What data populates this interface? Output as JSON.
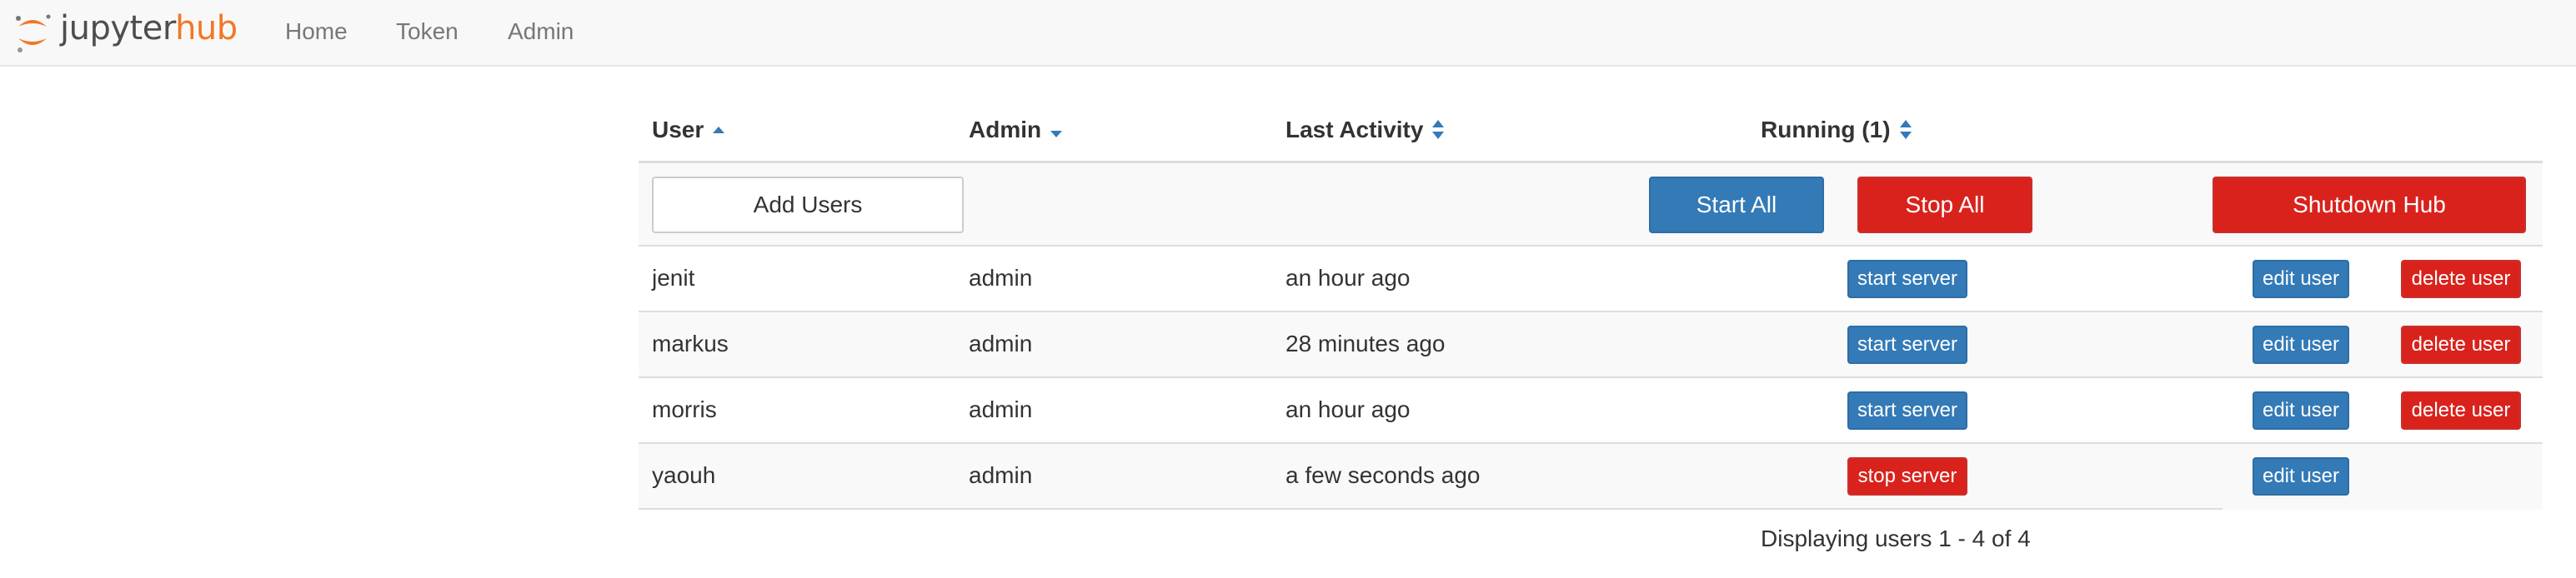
{
  "nav": {
    "logo_jupyter": "jupyter",
    "logo_hub": "hub",
    "links": [
      "Home",
      "Token",
      "Admin"
    ]
  },
  "table": {
    "headers": {
      "user": "User",
      "admin": "Admin",
      "last_activity": "Last Activity",
      "running": "Running (1)"
    },
    "controls": {
      "add_users": "Add Users",
      "start_all": "Start All",
      "stop_all": "Stop All",
      "shutdown_hub": "Shutdown Hub"
    },
    "rows": [
      {
        "user": "jenit",
        "admin": "admin",
        "last_activity": "an hour ago",
        "server_action": "start server",
        "edit": "edit user",
        "delete": "delete user"
      },
      {
        "user": "markus",
        "admin": "admin",
        "last_activity": "28 minutes ago",
        "server_action": "start server",
        "edit": "edit user",
        "delete": "delete user"
      },
      {
        "user": "morris",
        "admin": "admin",
        "last_activity": "an hour ago",
        "server_action": "start server",
        "edit": "edit user",
        "delete": "delete user"
      },
      {
        "user": "yaouh",
        "admin": "admin",
        "last_activity": "a few seconds ago",
        "server_action": "stop server",
        "edit": "edit user",
        "delete": ""
      }
    ],
    "footer": "Displaying users 1 - 4 of 4"
  },
  "colors": {
    "primary": "#337ab7",
    "danger": "#d9221c",
    "jupyter_orange": "#f37726"
  },
  "icons": {
    "logo": "jupyter-logo-icon",
    "sort_asc": "sort-ascending-icon",
    "sort_desc": "sort-descending-icon",
    "sort_both": "sort-both-icon"
  }
}
